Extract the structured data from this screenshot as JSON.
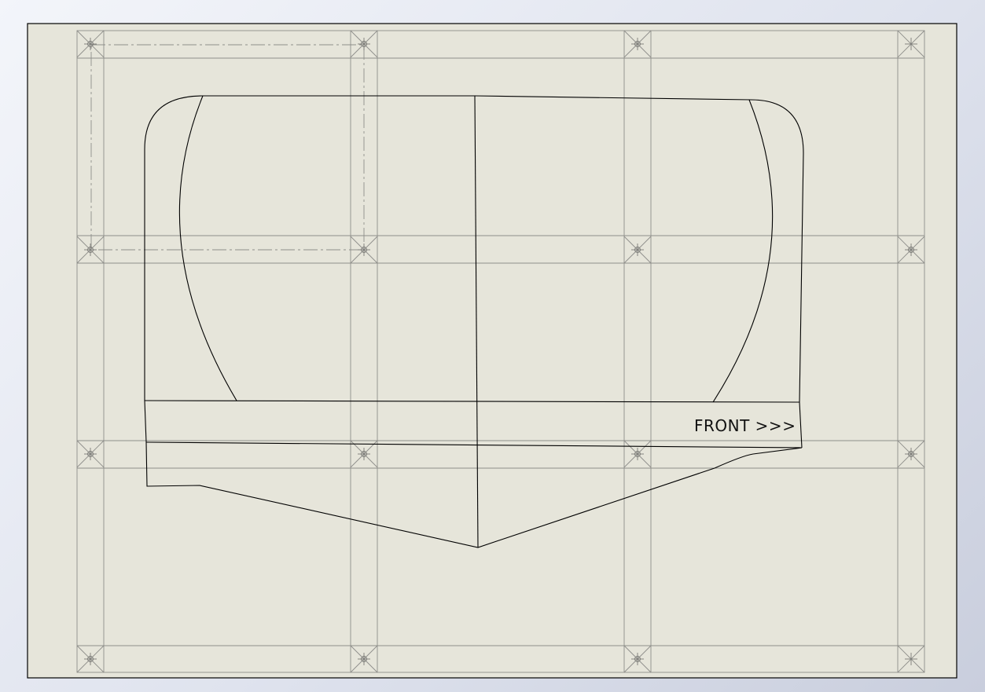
{
  "drawing": {
    "direction_label": "FRONT >>>"
  }
}
